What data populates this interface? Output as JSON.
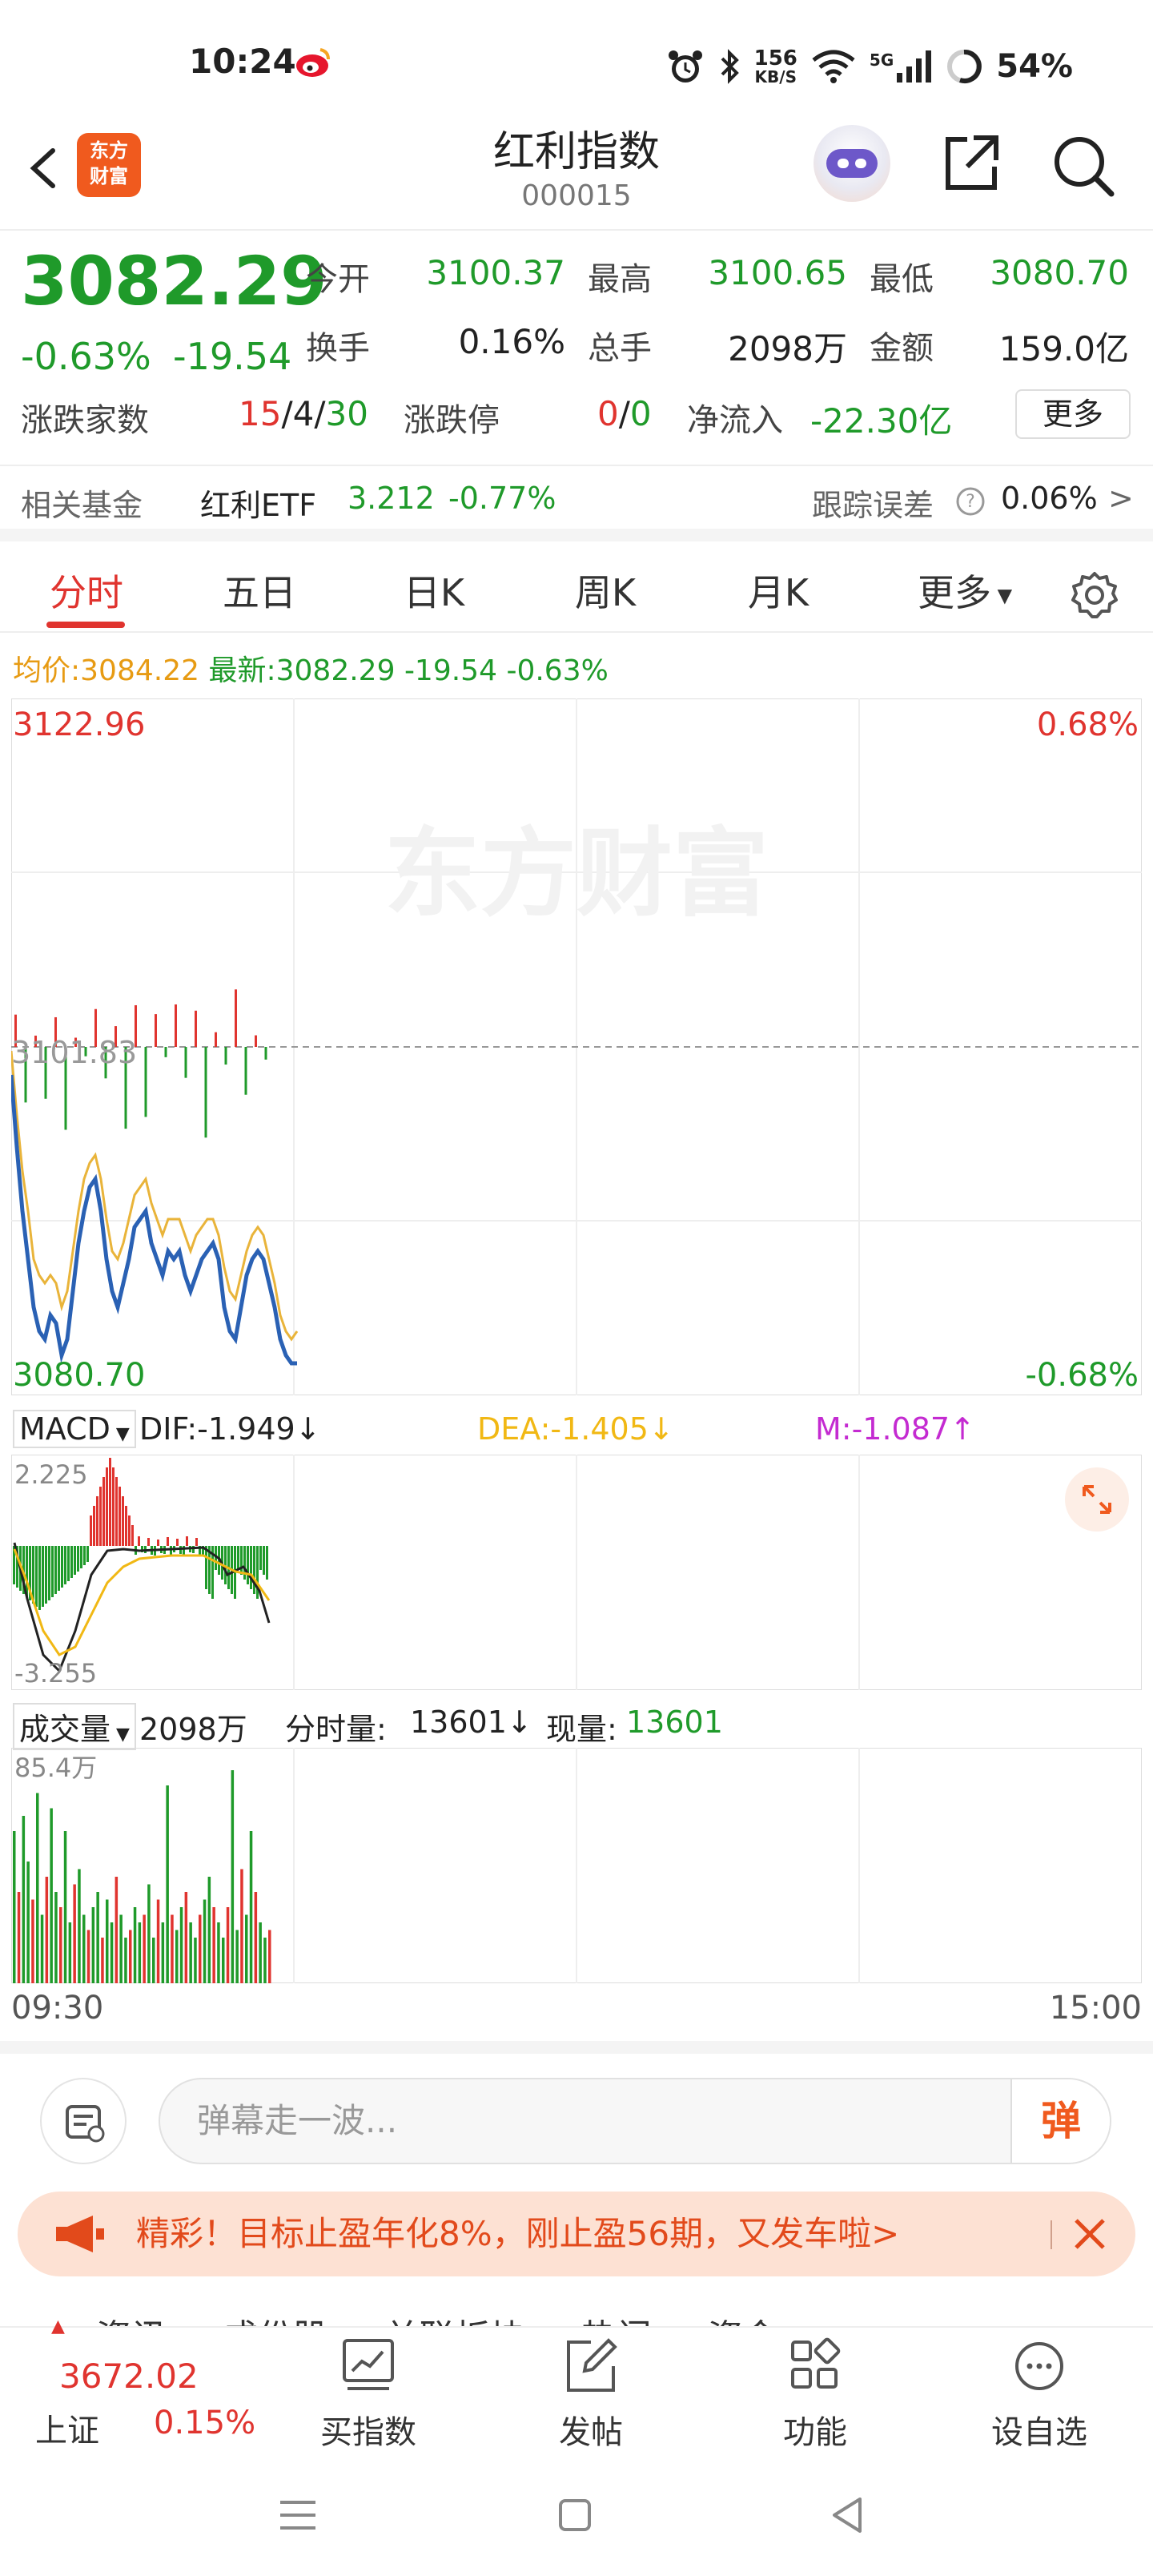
{
  "status": {
    "time": "10:24",
    "net_speed": "156",
    "net_unit": "KB/S",
    "signal": "5G",
    "battery": "54%"
  },
  "header": {
    "title": "红利指数",
    "code": "000015",
    "logo_line1": "东方",
    "logo_line2": "财富"
  },
  "quote": {
    "price": "3082.29",
    "change_pct": "-0.63%",
    "change": "-19.54",
    "open_label": "今开",
    "open": "3100.37",
    "high_label": "最高",
    "high": "3100.65",
    "low_label": "最低",
    "low": "3080.70",
    "turnover_label": "换手",
    "turnover": "0.16%",
    "volume_label": "总手",
    "volume": "2098万",
    "amount_label": "金额",
    "amount": "159.0亿",
    "breadth_label": "涨跌家数",
    "breadth_up": "15",
    "breadth_flat": "4",
    "breadth_down": "30",
    "limit_label": "涨跌停",
    "limit_up": "0",
    "limit_down": "0",
    "netflow_label": "净流入",
    "netflow": "-22.30亿",
    "more": "更多"
  },
  "fund": {
    "label": "相关基金",
    "name": "红利ETF",
    "price": "3.212",
    "pct": "-0.77%",
    "error_label": "跟踪误差",
    "error_value": "0.06%",
    "arrow": ">"
  },
  "tabs": [
    "分时",
    "五日",
    "日K",
    "周K",
    "月K",
    "更多"
  ],
  "avg": {
    "avg_label": "均价:",
    "avg_value": "3084.22",
    "latest_label": "最新:",
    "latest_value": "3082.29",
    "latest_change": "-19.54",
    "latest_pct": "-0.63%"
  },
  "main_chart": {
    "top_price": "3122.96",
    "top_pct": "0.68%",
    "bottom_price": "3080.70",
    "bottom_pct": "-0.68%",
    "mid_price": "3101.83",
    "watermark": "东方财富"
  },
  "macd": {
    "name": "MACD",
    "dif": "DIF:-1.949↓",
    "dea": "DEA:-1.405↓",
    "m": "M:-1.087↑",
    "max": "2.225",
    "min": "-3.255"
  },
  "vol": {
    "name": "成交量",
    "total": "2098万",
    "tick_label": "分时量:",
    "tick_value": "13601↓",
    "now_label": "现量:",
    "now_value": "13601",
    "max": "85.4万"
  },
  "time_axis": {
    "start": "09:30",
    "end": "15:00"
  },
  "danmu": {
    "placeholder": "弹幕走一波...",
    "button": "弹"
  },
  "ad": {
    "text": "精彩！目标止盈年化8%，刚止盈56期，又发车啦>"
  },
  "ghost_tabs": "资讯     成份股     关联板块     热门     资金",
  "bottom_nav": {
    "index_value": "3672.02",
    "index_name": "上证",
    "index_pct": "0.15%",
    "items": [
      "买指数",
      "发帖",
      "功能",
      "设自选"
    ]
  },
  "colors": {
    "up": "#e0342f",
    "down": "#1f9a2a",
    "avg": "#e79b13",
    "brand": "#f05a1e"
  }
}
